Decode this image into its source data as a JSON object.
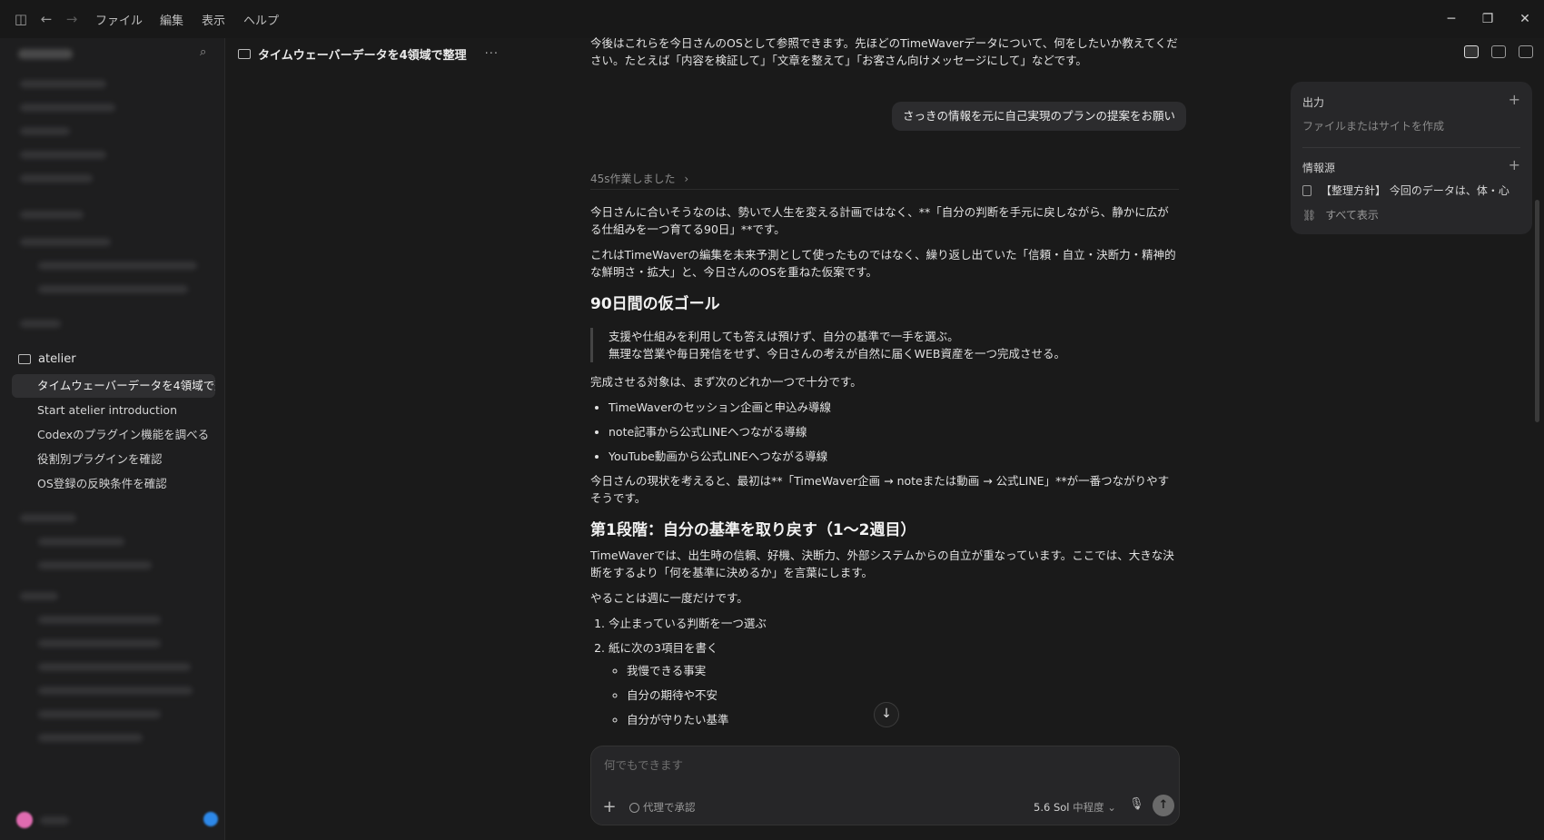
{
  "titlebar": {
    "menus": [
      "ファイル",
      "編集",
      "表示",
      "ヘルプ"
    ],
    "icons": [
      "sidebar-toggle-icon",
      "back-arrow-icon",
      "forward-arrow-icon"
    ],
    "window_controls": [
      "minimize-icon",
      "restore-icon",
      "close-icon"
    ]
  },
  "sidebar": {
    "folder_name": "atelier",
    "items": [
      "タイムウェーバーデータを4領域で整理",
      "Start atelier introduction",
      "Codexのプラグイン機能を調べる",
      "役割別プラグインを確認",
      "OS登録の反映条件を確認"
    ],
    "active_index": 0
  },
  "header": {
    "title": "タイムウェーバーデータを4領域で整理",
    "more": "···"
  },
  "chat": {
    "prev_text": "今後はこれらを今日さんのOSとして参照できます。先ほどのTimeWaverデータについて、何をしたいか教えてください。たとえば「内容を検証して」「文章を整えて」「お客さん向けメッセージにして」などです。",
    "user_message": "さっきの情報を元に自己実現のプランの提案をお願い",
    "meta": "45s作業しました",
    "p1": "今日さんに合いそうなのは、勢いで人生を変える計画ではなく、**「自分の判断を手元に戻しながら、静かに広がる仕組みを一つ育てる90日」**です。",
    "p2": "これはTimeWaverの編集を未来予測として使ったものではなく、繰り返し出ていた「信頼・自立・決断力・精神的な鮮明さ・拡大」と、今日さんのOSを重ねた仮案です。",
    "h1": "90日間の仮ゴール",
    "quote_1": "支援や仕組みを利用しても答えは預けず、自分の基準で一手を選ぶ。",
    "quote_2": "無理な営業や毎日発信をせず、今日さんの考えが自然に届くWEB資産を一つ完成させる。",
    "p3": "完成させる対象は、まず次のどれか一つで十分です。",
    "bullets": [
      "TimeWaverのセッション企画と申込み導線",
      "note記事から公式LINEへつながる導線",
      "YouTube動画から公式LINEへつながる導線"
    ],
    "p4": "今日さんの現状を考えると、最初は**「TimeWaver企画 → noteまたは動画 → 公式LINE」**が一番つながりやすそうです。",
    "h2": "第1段階：自分の基準を取り戻す（1〜2週目）",
    "p5": "TimeWaverでは、出生時の信頼、好機、決断力、外部システムからの自立が重なっています。ここでは、大きな決断をするより「何を基準に決めるか」を言葉にします。",
    "p6": "やることは週に一度だけです。",
    "steps": [
      "今止まっている判断を一つ選ぶ",
      "紙に次の3項目を書く"
    ],
    "substeps": [
      "我慢できる事実",
      "自分の期待や不安",
      "自分が守りたい基準"
    ]
  },
  "composer": {
    "placeholder": "何でもできます",
    "approve_label": "代理で承認",
    "model": "5.6 Sol",
    "effort": "中程度"
  },
  "right_panel": {
    "output_title": "出力",
    "output_hint": "ファイルまたはサイトを作成",
    "sources_title": "情報源",
    "source_item": "【整理方針】 今回のデータは、体・心",
    "show_all": "すべて表示"
  }
}
